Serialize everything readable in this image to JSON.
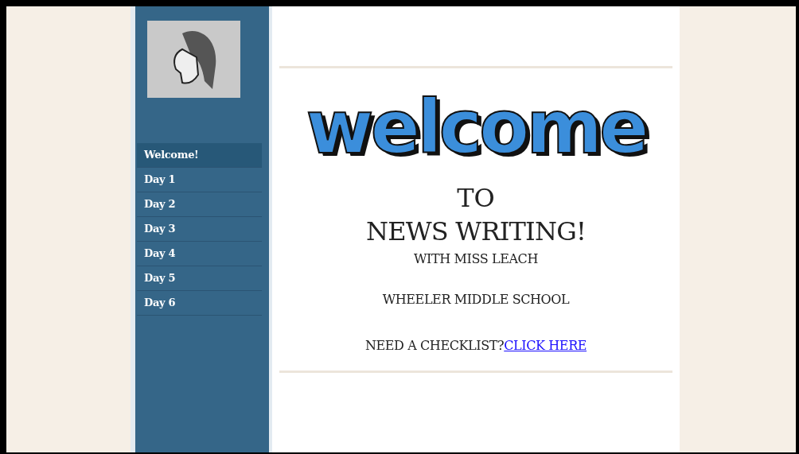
{
  "sidebar": {
    "items": [
      {
        "label": "Welcome!",
        "selected": true
      },
      {
        "label": "Day 1",
        "selected": false
      },
      {
        "label": "Day 2",
        "selected": false
      },
      {
        "label": "Day 3",
        "selected": false
      },
      {
        "label": "Day 4",
        "selected": false
      },
      {
        "label": "Day 5",
        "selected": false
      },
      {
        "label": "Day 6",
        "selected": false
      }
    ]
  },
  "content": {
    "welcome_graphic": "welcome",
    "heading_to": "TO",
    "heading_main": "NEWS WRITING!",
    "teacher": "WITH MISS LEACH",
    "school": "WHEELER MIDDLE SCHOOL",
    "checklist_prompt": "NEED A CHECKLIST?",
    "checklist_link": "CLICK HERE"
  }
}
